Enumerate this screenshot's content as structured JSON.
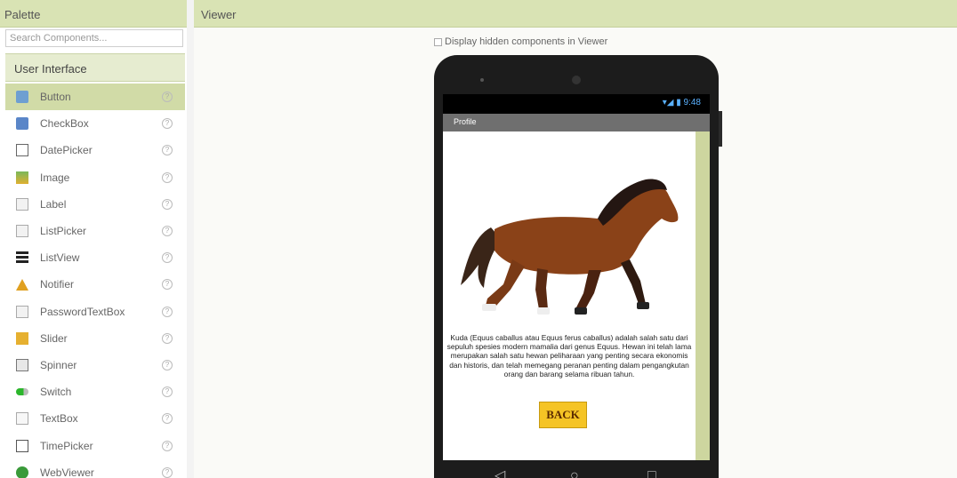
{
  "palette": {
    "title": "Palette",
    "search_placeholder": "Search Components...",
    "category": "User Interface",
    "components": [
      {
        "label": "Button",
        "icon": "button-icon",
        "selected": true
      },
      {
        "label": "CheckBox",
        "icon": "checkbox-icon"
      },
      {
        "label": "DatePicker",
        "icon": "datepicker-icon"
      },
      {
        "label": "Image",
        "icon": "image-icon"
      },
      {
        "label": "Label",
        "icon": "label-icon"
      },
      {
        "label": "ListPicker",
        "icon": "listpicker-icon"
      },
      {
        "label": "ListView",
        "icon": "listview-icon"
      },
      {
        "label": "Notifier",
        "icon": "notifier-icon"
      },
      {
        "label": "PasswordTextBox",
        "icon": "password-icon"
      },
      {
        "label": "Slider",
        "icon": "slider-icon"
      },
      {
        "label": "Spinner",
        "icon": "spinner-icon"
      },
      {
        "label": "Switch",
        "icon": "switch-icon"
      },
      {
        "label": "TextBox",
        "icon": "textbox-icon"
      },
      {
        "label": "TimePicker",
        "icon": "timepicker-icon"
      },
      {
        "label": "WebViewer",
        "icon": "webviewer-icon"
      }
    ],
    "help_glyph": "?"
  },
  "viewer": {
    "title": "Viewer",
    "hidden_toggle_label": "Display hidden components in Viewer",
    "phone": {
      "status_icons": "▾◢ ▮ 9:48",
      "screen_title": "Profile",
      "description": "Kuda (Equus caballus atau Equus ferus caballus) adalah salah satu dari sepuluh spesies modern mamalia dari genus Equus. Hewan ini telah lama merupakan salah satu hewan peliharaan yang penting secara ekonomis dan historis, dan telah memegang peranan penting dalam pengangkutan orang dan barang selama ribuan tahun.",
      "back_button": "BACK",
      "nav_back": "◁",
      "nav_home": "○",
      "nav_recent": "□"
    }
  },
  "colors": {
    "header_bg": "#d9e3b4",
    "selected_bg": "#d1dba7",
    "button_bg": "#f5c425"
  }
}
